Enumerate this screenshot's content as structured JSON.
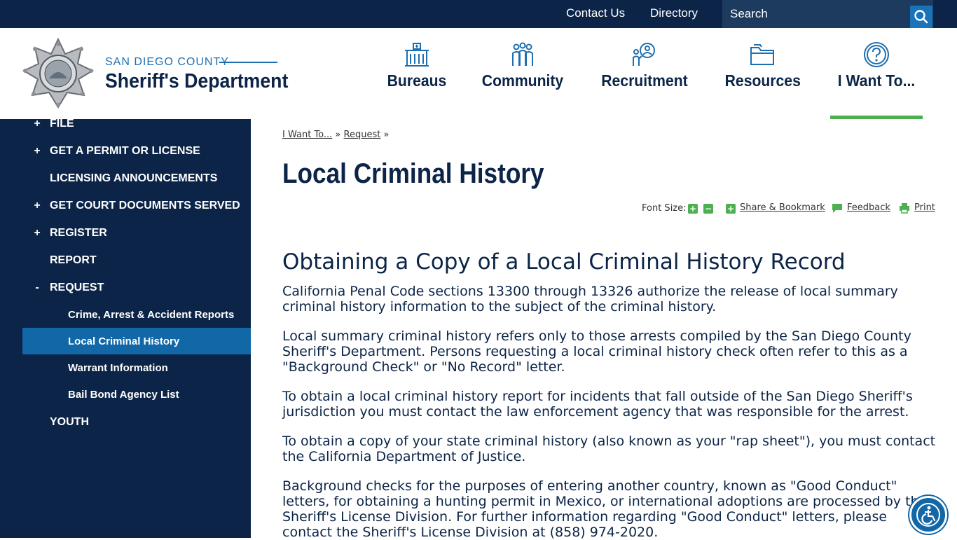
{
  "topbar": {
    "links": [
      "Contact Us",
      "Directory"
    ],
    "search_placeholder": "Search"
  },
  "brand": {
    "small": "SAN DIEGO COUNTY",
    "big": "Sheriff's Department"
  },
  "nav": [
    {
      "label": "Bureaus",
      "icon": "building-icon"
    },
    {
      "label": "Community",
      "icon": "people-group-icon"
    },
    {
      "label": "Recruitment",
      "icon": "recruit-search-icon"
    },
    {
      "label": "Resources",
      "icon": "folder-icon"
    },
    {
      "label": "I Want To...",
      "icon": "question-circle-icon"
    }
  ],
  "sidebar": {
    "items": [
      {
        "toggle": "+",
        "label": "FILE"
      },
      {
        "toggle": "+",
        "label": "GET A PERMIT OR LICENSE"
      },
      {
        "toggle": "",
        "label": "LICENSING ANNOUNCEMENTS"
      },
      {
        "toggle": "+",
        "label": "GET COURT DOCUMENTS SERVED"
      },
      {
        "toggle": "+",
        "label": "REGISTER"
      },
      {
        "toggle": "",
        "label": "REPORT"
      },
      {
        "toggle": "-",
        "label": "REQUEST"
      },
      {
        "toggle": "",
        "label": "YOUTH"
      }
    ],
    "sub_items": [
      {
        "label": "Crime, Arrest & Accident Reports"
      },
      {
        "label": "Local Criminal History"
      },
      {
        "label": "Warrant Information"
      },
      {
        "label": "Bail Bond Agency List"
      }
    ]
  },
  "breadcrumb": {
    "items": [
      "I Want To...",
      "Request"
    ],
    "sep": "»"
  },
  "page": {
    "title": "Local Criminal History",
    "tools": {
      "font_size_label": "Font Size:",
      "share": "Share & Bookmark",
      "feedback": "Feedback",
      "print": "Print"
    },
    "heading": "Obtaining a Copy of a Local Criminal History Record",
    "paragraphs": [
      "California Penal Code sections 13300 through 13326 authorize the release of local summary criminal history information to the subject of the criminal history.",
      "Local summary criminal history refers only to those arrests compiled by the San Diego County Sheriff's Department. Persons requesting a local criminal history check often refer to this as a \"Background Check\" or \"No Record\" letter.",
      "To obtain a local criminal history report for incidents that fall outside of the San Diego Sheriff's jurisdiction you must contact the law enforcement agency that was responsible for the arrest.",
      "To obtain a copy of your state criminal history (also known as your \"rap sheet\"), you must contact the California Department of Justice.",
      "Background checks for the purposes of entering another country, known as \"Good Conduct\" letters, for obtaining a hunting permit in Mexico, or international adoptions are processed by the Sheriff's License Division. For further information regarding \"Good Conduct\" letters, please contact the Sheriff's License Division at (858) 974-2020."
    ]
  },
  "colors": {
    "navy": "#0b2447",
    "accent_blue": "#1e6fb0",
    "active_green": "#4cb050"
  }
}
